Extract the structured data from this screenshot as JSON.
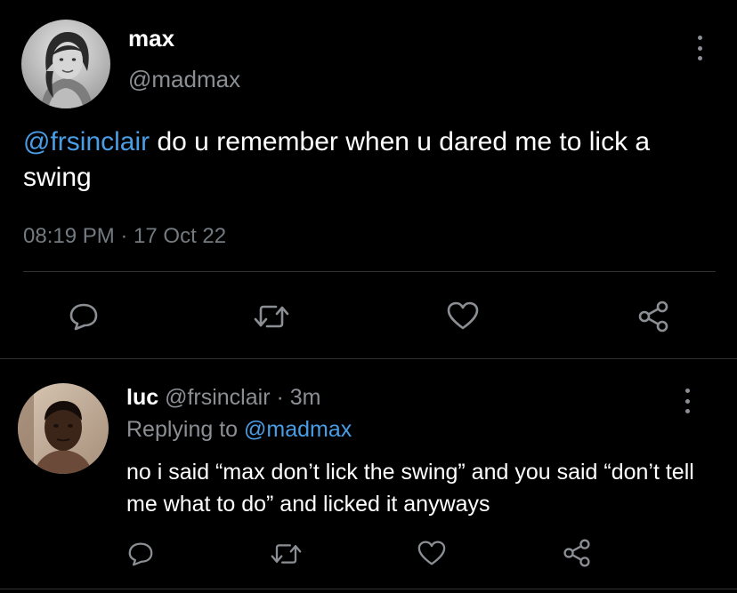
{
  "main_tweet": {
    "display_name": "max",
    "handle": "@madmax",
    "mention": "@frsinclair",
    "text": " do u remember when u dared me to lick a swing",
    "timestamp": "08:19 PM · 17 Oct 22"
  },
  "reply": {
    "display_name": "luc",
    "handle": "@frsinclair",
    "time_sep": " · ",
    "time": "3m",
    "replying_prefix": "Replying to ",
    "replying_to": "@madmax",
    "text": "no i said “max don’t lick the swing” and you said “don’t tell me what to do” and licked it anyways"
  },
  "colors": {
    "background": "#000000",
    "primary_text": "#ffffff",
    "secondary_text": "#8b8f94",
    "link": "#4a9de4",
    "divider": "#2f3336",
    "icon": "#8b8f94"
  },
  "icons": {
    "reply": "speech-bubble-icon",
    "retweet": "retweet-icon",
    "like": "heart-icon",
    "share": "share-nodes-icon",
    "more": "vertical-ellipsis-icon"
  }
}
